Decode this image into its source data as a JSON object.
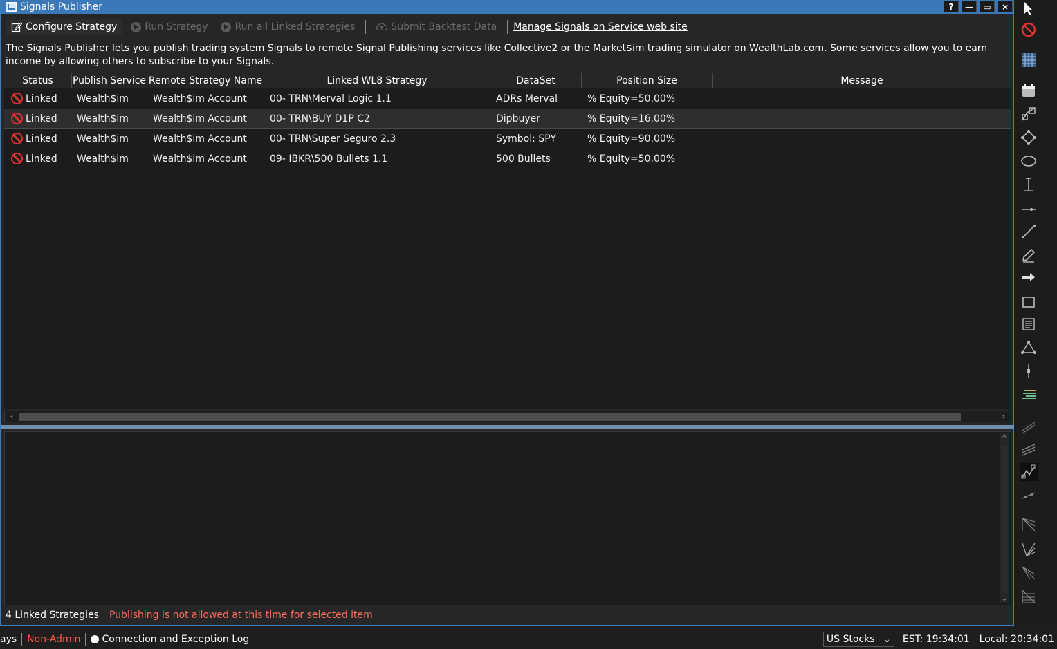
{
  "window": {
    "title": "Signals Publisher",
    "controls": [
      "?",
      "—",
      "▭",
      "×"
    ]
  },
  "toolbar": {
    "configure": "Configure Strategy",
    "run": "Run Strategy",
    "run_all": "Run all Linked Strategies",
    "submit": "Submit Backtest Data",
    "manage_link": "Manage Signals on Service web site"
  },
  "description": "The Signals Publisher lets you publish trading system Signals to remote Signal Publishing services like Collective2 or the Market$im trading simulator on WealthLab.com. Some services allow you to earn income by allowing others to subscribe to your Signals.",
  "table": {
    "headers": [
      "Status",
      "Publish Service",
      "Remote Strategy Name",
      "Linked WL8 Strategy",
      "DataSet",
      "Position Size",
      "Message"
    ],
    "rows": [
      {
        "status": "Linked",
        "service": "Wealth$im",
        "remote": "Wealth$im Account",
        "strategy": "00- TRN\\Merval Logic 1.1",
        "dataset": "ADRs Merval",
        "size": "% Equity=50.00%",
        "message": ""
      },
      {
        "status": "Linked",
        "service": "Wealth$im",
        "remote": "Wealth$im Account",
        "strategy": "00- TRN\\BUY D1P C2",
        "dataset": "Dipbuyer",
        "size": "% Equity=16.00%",
        "message": ""
      },
      {
        "status": "Linked",
        "service": "Wealth$im",
        "remote": "Wealth$im Account",
        "strategy": "00- TRN\\Super Seguro 2.3",
        "dataset": "Symbol: SPY",
        "size": "% Equity=90.00%",
        "message": ""
      },
      {
        "status": "Linked",
        "service": "Wealth$im",
        "remote": "Wealth$im Account",
        "strategy": "09- IBKR\\500 Bullets 1.1",
        "dataset": "500 Bullets",
        "size": "% Equity=50.00%",
        "message": ""
      }
    ],
    "selected_row": 1
  },
  "window_status": {
    "count": "4 Linked Strategies",
    "warning": "Publishing is not allowed at this time for selected item"
  },
  "app_status": {
    "partial_left": "ays",
    "non_admin": "Non-Admin",
    "connection": "Connection and Exception Log",
    "market": "US Stocks",
    "est": "EST: 19:34:01",
    "local": "Local: 20:34:01"
  },
  "colors": {
    "accent": "#3b78b8",
    "error": "#e03131",
    "warning_text": "#ff6b5e"
  },
  "side_tools": [
    "pointer-icon",
    "no-entry-icon",
    "grid-icon",
    "calendar-icon",
    "fib-icon",
    "node-icon",
    "ellipse-icon",
    "vertical-line-icon",
    "horizontal-line-icon",
    "trend-line-icon",
    "pencil-icon",
    "arrow-icon",
    "rectangle-icon",
    "text-icon",
    "triangle-icon",
    "candle-icon",
    "bars-icon",
    "line-study-icon",
    "channel-icon",
    "pattern-icon",
    "ray-icon",
    "fan-icon",
    "fan2-icon",
    "fan3-icon",
    "fan4-icon"
  ]
}
